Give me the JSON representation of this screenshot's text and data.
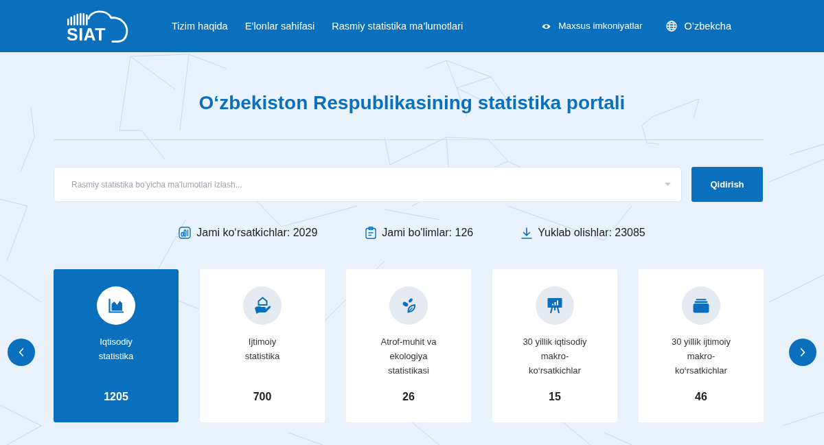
{
  "header": {
    "logo": "SIAT",
    "nav": [
      "Tizim haqida",
      "E’lonlar sahifasi",
      "Rasmiy statistika ma’lumotlari"
    ],
    "accessibility": "Maxsus imkoniyatlar",
    "language": "O’zbekcha"
  },
  "title": "O‘zbekiston Respublikasining statistika portali",
  "search": {
    "placeholder": "Rasmiy statistika bo'yicha ma'lumotlari izlash...",
    "button": "Qidirish"
  },
  "stats": [
    {
      "kind": "chart",
      "text": "Jami ko‘rsatkichlar: 2029"
    },
    {
      "kind": "clipboard",
      "text": "Jami bo'limlar: 126"
    },
    {
      "kind": "download",
      "text": "Yuklab olishlar: 23085"
    }
  ],
  "categories": [
    {
      "kind": "area-chart",
      "label": "Iqtisodiy\nstatistika",
      "count": "1205",
      "selected": true
    },
    {
      "kind": "hand-house",
      "label": "Ijtimoiy\nstatistika",
      "count": "700",
      "selected": false
    },
    {
      "kind": "leaves",
      "label": "Atrof-muhit va\nekologiya\nstatistikasi",
      "count": "26",
      "selected": false
    },
    {
      "kind": "presentation",
      "label": "30 yillik iqtisodiy\nmakro-\nko‘rsatkichlar",
      "count": "15",
      "selected": false
    },
    {
      "kind": "stack",
      "label": "30 yillik ijtimoiy\nmakro-\nko‘rsatkichlar",
      "count": "46",
      "selected": false
    }
  ]
}
